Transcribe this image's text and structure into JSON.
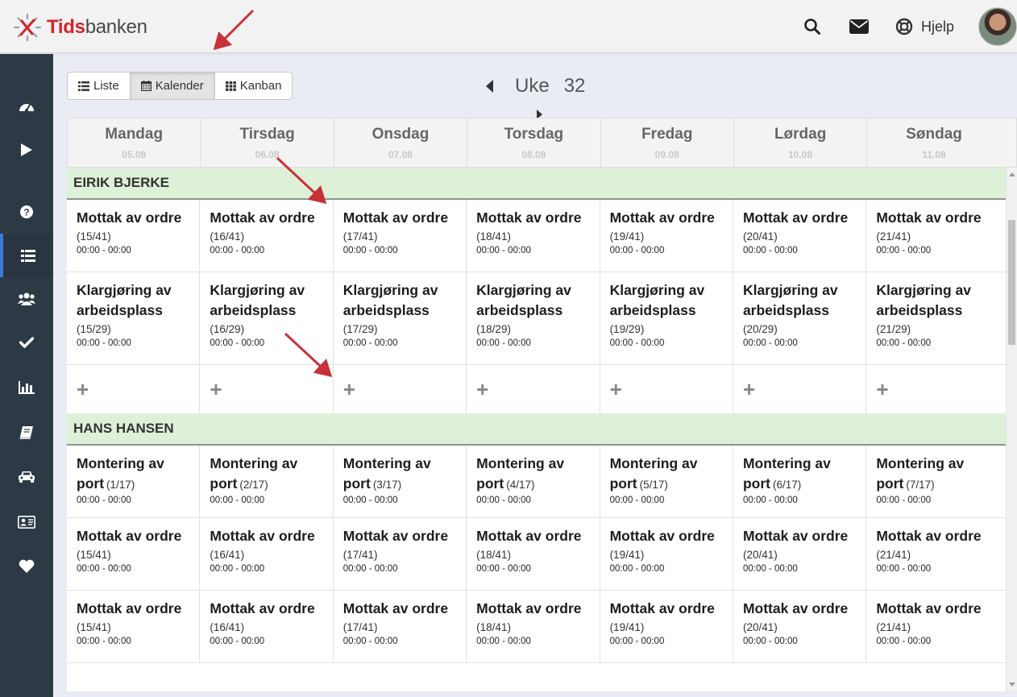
{
  "brand": {
    "name_part1": "Tids",
    "name_part2": "banken",
    "color": "#d3232a"
  },
  "header": {
    "icons": [
      "search-icon",
      "mail-icon",
      "lifebuoy-icon"
    ],
    "help_label": "Hjelp"
  },
  "sidebar": {
    "items": [
      {
        "icon": "dashboard-icon"
      },
      {
        "icon": "play-icon"
      },
      {
        "icon": "question-icon"
      },
      {
        "icon": "list-icon",
        "active": true
      },
      {
        "icon": "users-icon"
      },
      {
        "icon": "check-icon"
      },
      {
        "icon": "bar-chart-icon"
      },
      {
        "icon": "book-icon"
      },
      {
        "icon": "car-icon"
      },
      {
        "icon": "id-card-icon"
      },
      {
        "icon": "heart-icon"
      }
    ],
    "active_color": "#3a7bd5"
  },
  "views": {
    "list": "Liste",
    "calendar": "Kalender",
    "kanban": "Kanban",
    "active": "calendar"
  },
  "week": {
    "label": "Uke",
    "number": "32"
  },
  "days": [
    {
      "name": "Mandag",
      "date": "05.08"
    },
    {
      "name": "Tirsdag",
      "date": "06.08"
    },
    {
      "name": "Onsdag",
      "date": "07.08"
    },
    {
      "name": "Torsdag",
      "date": "08.08"
    },
    {
      "name": "Fredag",
      "date": "09.08"
    },
    {
      "name": "Lørdag",
      "date": "10.08"
    },
    {
      "name": "Søndag",
      "date": "11.08"
    }
  ],
  "groups": [
    {
      "name": "EIRIK BJERKE",
      "rows": [
        {
          "cells": [
            {
              "title": "Mottak av ordre",
              "count": "(15/41)",
              "time": "00:00 - 00:00"
            },
            {
              "title": "Mottak av ordre",
              "count": "(16/41)",
              "time": "00:00 - 00:00"
            },
            {
              "title": "Mottak av ordre",
              "count": "(17/41)",
              "time": "00:00 - 00:00"
            },
            {
              "title": "Mottak av ordre",
              "count": "(18/41)",
              "time": "00:00 - 00:00"
            },
            {
              "title": "Mottak av ordre",
              "count": "(19/41)",
              "time": "00:00 - 00:00"
            },
            {
              "title": "Mottak av ordre",
              "count": "(20/41)",
              "time": "00:00 - 00:00"
            },
            {
              "title": "Mottak av ordre",
              "count": "(21/41)",
              "time": "00:00 - 00:00"
            }
          ]
        },
        {
          "cells": [
            {
              "title": "Klargjøring av arbeidsplass",
              "count": "(15/29)",
              "time": "00:00 - 00:00"
            },
            {
              "title": "Klargjøring av arbeidsplass",
              "count": "(16/29)",
              "time": "00:00 - 00:00"
            },
            {
              "title": "Klargjøring av arbeidsplass",
              "count": "(17/29)",
              "time": "00:00 - 00:00"
            },
            {
              "title": "Klargjøring av arbeidsplass",
              "count": "(18/29)",
              "time": "00:00 - 00:00"
            },
            {
              "title": "Klargjøring av arbeidsplass",
              "count": "(19/29)",
              "time": "00:00 - 00:00"
            },
            {
              "title": "Klargjøring av arbeidsplass",
              "count": "(20/29)",
              "time": "00:00 - 00:00"
            },
            {
              "title": "Klargjøring av arbeidsplass",
              "count": "(21/29)",
              "time": "00:00 - 00:00"
            }
          ]
        }
      ],
      "add_symbol": "+"
    },
    {
      "name": "HANS HANSEN",
      "rows": [
        {
          "cells": [
            {
              "title": "Montering av port",
              "count": "(1/17)",
              "time": "00:00 - 00:00"
            },
            {
              "title": "Montering av port",
              "count": "(2/17)",
              "time": "00:00 - 00:00"
            },
            {
              "title": "Montering av port",
              "count": "(3/17)",
              "time": "00:00 - 00:00"
            },
            {
              "title": "Montering av port",
              "count": "(4/17)",
              "time": "00:00 - 00:00"
            },
            {
              "title": "Montering av port",
              "count": "(5/17)",
              "time": "00:00 - 00:00"
            },
            {
              "title": "Montering av port",
              "count": "(6/17)",
              "time": "00:00 - 00:00"
            },
            {
              "title": "Montering av port",
              "count": "(7/17)",
              "time": "00:00 - 00:00"
            }
          ]
        },
        {
          "cells": [
            {
              "title": "Mottak av ordre",
              "count": "(15/41)",
              "time": "00:00 - 00:00"
            },
            {
              "title": "Mottak av ordre",
              "count": "(16/41)",
              "time": "00:00 - 00:00"
            },
            {
              "title": "Mottak av ordre",
              "count": "(17/41)",
              "time": "00:00 - 00:00"
            },
            {
              "title": "Mottak av ordre",
              "count": "(18/41)",
              "time": "00:00 - 00:00"
            },
            {
              "title": "Mottak av ordre",
              "count": "(19/41)",
              "time": "00:00 - 00:00"
            },
            {
              "title": "Mottak av ordre",
              "count": "(20/41)",
              "time": "00:00 - 00:00"
            },
            {
              "title": "Mottak av ordre",
              "count": "(21/41)",
              "time": "00:00 - 00:00"
            }
          ]
        },
        {
          "cells": [
            {
              "title": "Mottak av ordre",
              "count": "(15/41)",
              "time": "00:00 - 00:00"
            },
            {
              "title": "Mottak av ordre",
              "count": "(16/41)",
              "time": "00:00 - 00:00"
            },
            {
              "title": "Mottak av ordre",
              "count": "(17/41)",
              "time": "00:00 - 00:00"
            },
            {
              "title": "Mottak av ordre",
              "count": "(18/41)",
              "time": "00:00 - 00:00"
            },
            {
              "title": "Mottak av ordre",
              "count": "(19/41)",
              "time": "00:00 - 00:00"
            },
            {
              "title": "Mottak av ordre",
              "count": "(20/41)",
              "time": "00:00 - 00:00"
            },
            {
              "title": "Mottak av ordre",
              "count": "(21/41)",
              "time": "00:00 - 00:00"
            }
          ]
        }
      ]
    }
  ],
  "colors": {
    "group_header_bg": "#dff0d8",
    "sidebar_bg": "#2d3a46",
    "annotation_arrow": "#c8303a"
  }
}
